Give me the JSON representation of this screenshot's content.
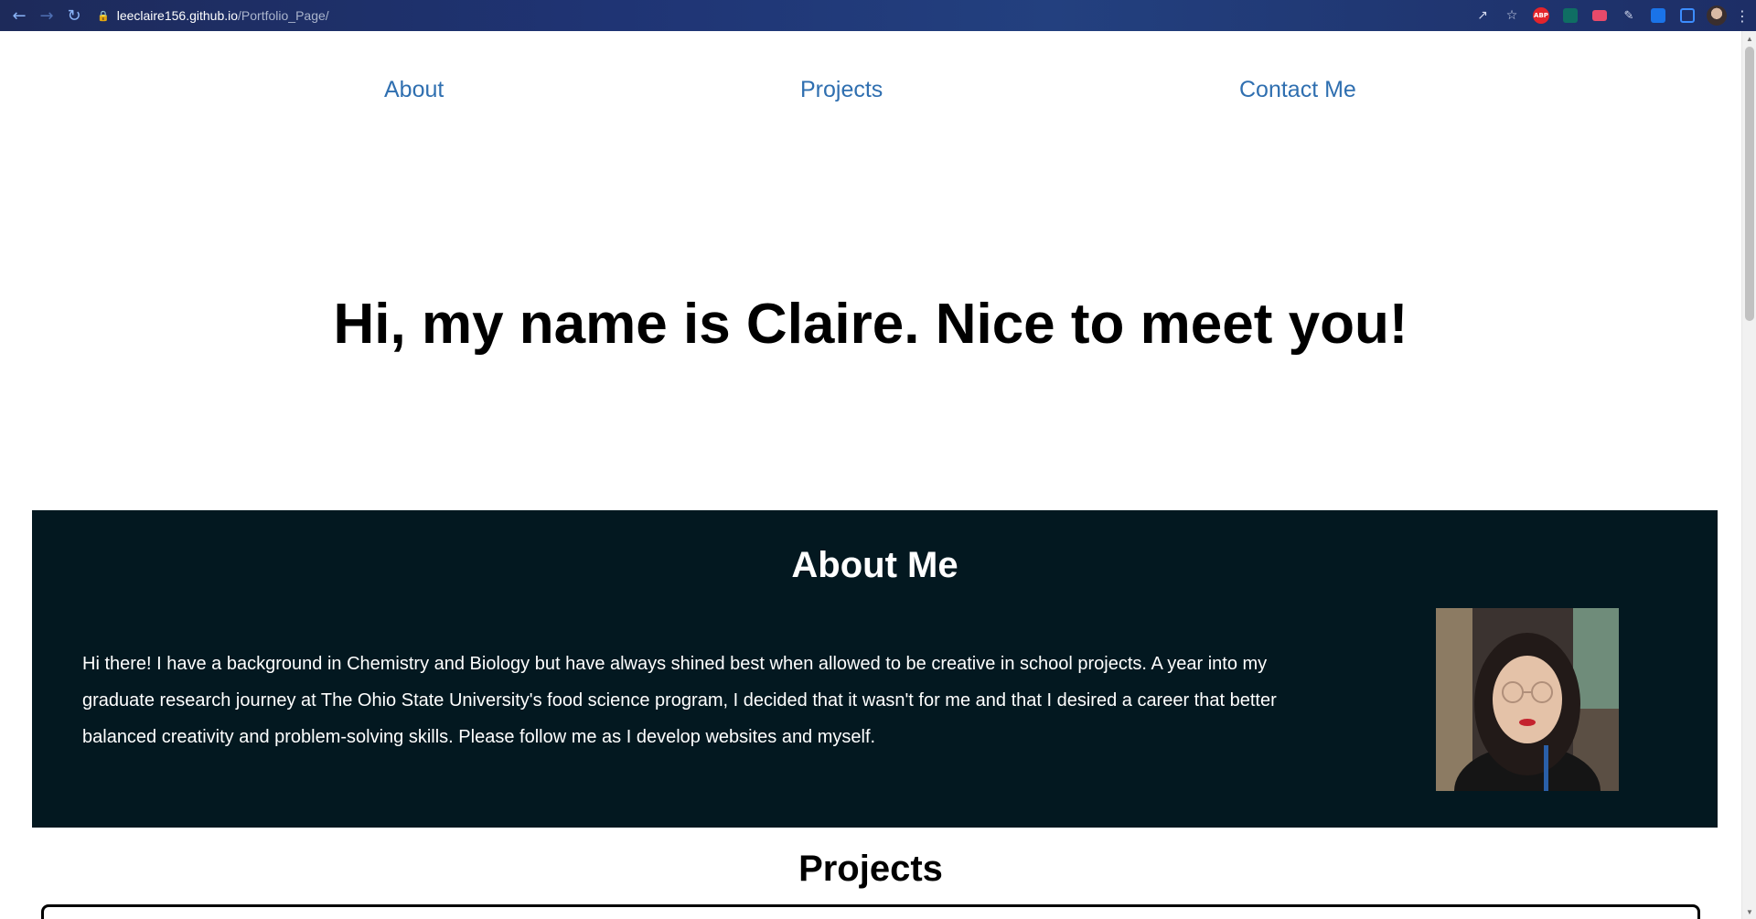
{
  "browser": {
    "url_host": "leeclaire156.github.io",
    "url_path": "/Portfolio_Page/",
    "extensions": {
      "abp_label": "ABP"
    }
  },
  "nav": {
    "about": "About",
    "projects": "Projects",
    "contact": "Contact Me"
  },
  "hero": {
    "title": "Hi, my name is Claire. Nice to meet you!"
  },
  "about": {
    "heading": "About Me",
    "body": "Hi there! I have a background in Chemistry and Biology but have always shined best when allowed to be creative in school projects. A year into my graduate research journey at The Ohio State University's food science program, I decided that it wasn't for me and that I desired a career that better balanced creativity and problem-solving skills. Please follow me as I develop websites and myself."
  },
  "projects": {
    "heading": "Projects"
  },
  "colors": {
    "link": "#2f6fb0",
    "about_bg": "#031820",
    "chrome": "#1f3474"
  },
  "icons": [
    "back-arrow-icon",
    "forward-arrow-icon",
    "reload-icon",
    "lock-icon",
    "share-icon",
    "star-icon",
    "kebab-menu-icon"
  ]
}
